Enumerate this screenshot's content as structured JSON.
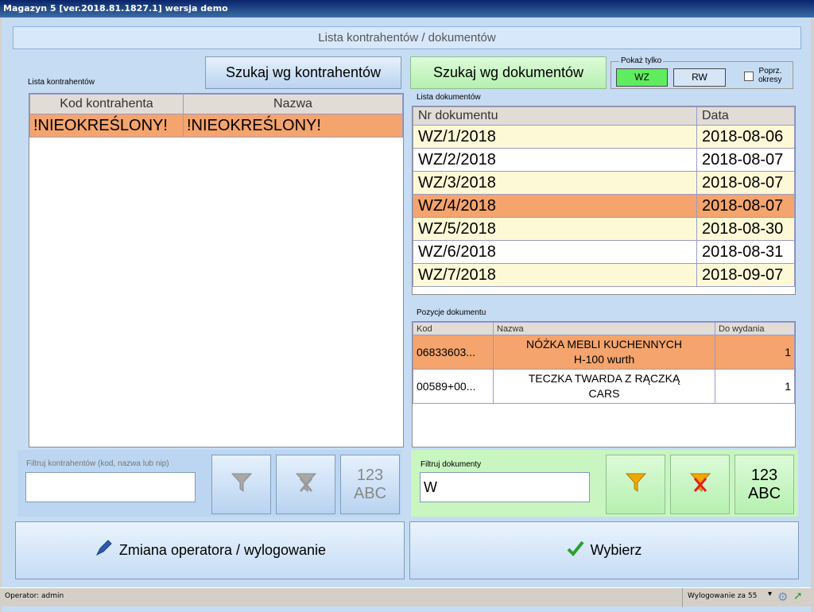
{
  "window": {
    "title": "Magazyn 5 [ver.2018.81.1827.1]  wersja demo"
  },
  "header": {
    "title": "Lista kontrahentów / dokumentów"
  },
  "contractors": {
    "search_button": "Szukaj wg kontrahentów",
    "list_label": "Lista kontrahentów",
    "columns": [
      "Kod kontrahenta",
      "Nazwa"
    ],
    "rows": [
      {
        "code": "!NIEOKREŚLONY!",
        "name": "!NIEOKREŚLONY!"
      }
    ],
    "filter_label": "Filtruj kontrahentów (kod, nazwa lub nip)",
    "filter_value": "",
    "keyboard_label_1": "123",
    "keyboard_label_2": "ABC"
  },
  "documents": {
    "search_button": "Szukaj wg dokumentów",
    "show_only": {
      "label": "Pokaż tylko",
      "wz": "WZ",
      "rw": "RW",
      "prev_label_1": "Poprz.",
      "prev_label_2": "okresy"
    },
    "list_label": "Lista dokumentów",
    "columns": [
      "Nr dokumentu",
      "Data"
    ],
    "rows": [
      {
        "nr": "WZ/1/2018",
        "date": "2018-08-06"
      },
      {
        "nr": "WZ/2/2018",
        "date": "2018-08-07"
      },
      {
        "nr": "WZ/3/2018",
        "date": "2018-08-07"
      },
      {
        "nr": "WZ/4/2018",
        "date": "2018-08-07"
      },
      {
        "nr": "WZ/5/2018",
        "date": "2018-08-30"
      },
      {
        "nr": "WZ/6/2018",
        "date": "2018-08-31"
      },
      {
        "nr": "WZ/7/2018",
        "date": "2018-09-07"
      }
    ],
    "positions_label": "Pozycje dokumentu",
    "pos_columns": [
      "Kod",
      "Nazwa",
      "Do wydania"
    ],
    "positions": [
      {
        "code": "06833603...",
        "name_1": "NÓŻKA MEBLI KUCHENNYCH",
        "name_2": "H-100 wurth",
        "qty": "1"
      },
      {
        "code": "00589+00...",
        "name_1": "TECZKA TWARDA Z RĄCZKĄ",
        "name_2": "CARS",
        "qty": "1"
      }
    ],
    "filter_label": "Filtruj dokumenty",
    "filter_value": "W",
    "keyboard_label_1": "123",
    "keyboard_label_2": "ABC"
  },
  "actions": {
    "change_operator": "Zmiana operatora / wylogowanie",
    "select": "Wybierz"
  },
  "status": {
    "operator": "Operator: admin",
    "logout": "Wylogowanie za 55"
  },
  "colors": {
    "selected_row": "#f4a46c",
    "alt_row": "#fdf9d7",
    "green_panel": "#c8f5c0",
    "blue_panel": "#c6dcf3",
    "title_bar": "#0a246a"
  },
  "icons": [
    "funnel-icon",
    "funnel-clear-icon",
    "pen-icon",
    "checkmark-icon",
    "gear-icon",
    "exit-icon"
  ]
}
